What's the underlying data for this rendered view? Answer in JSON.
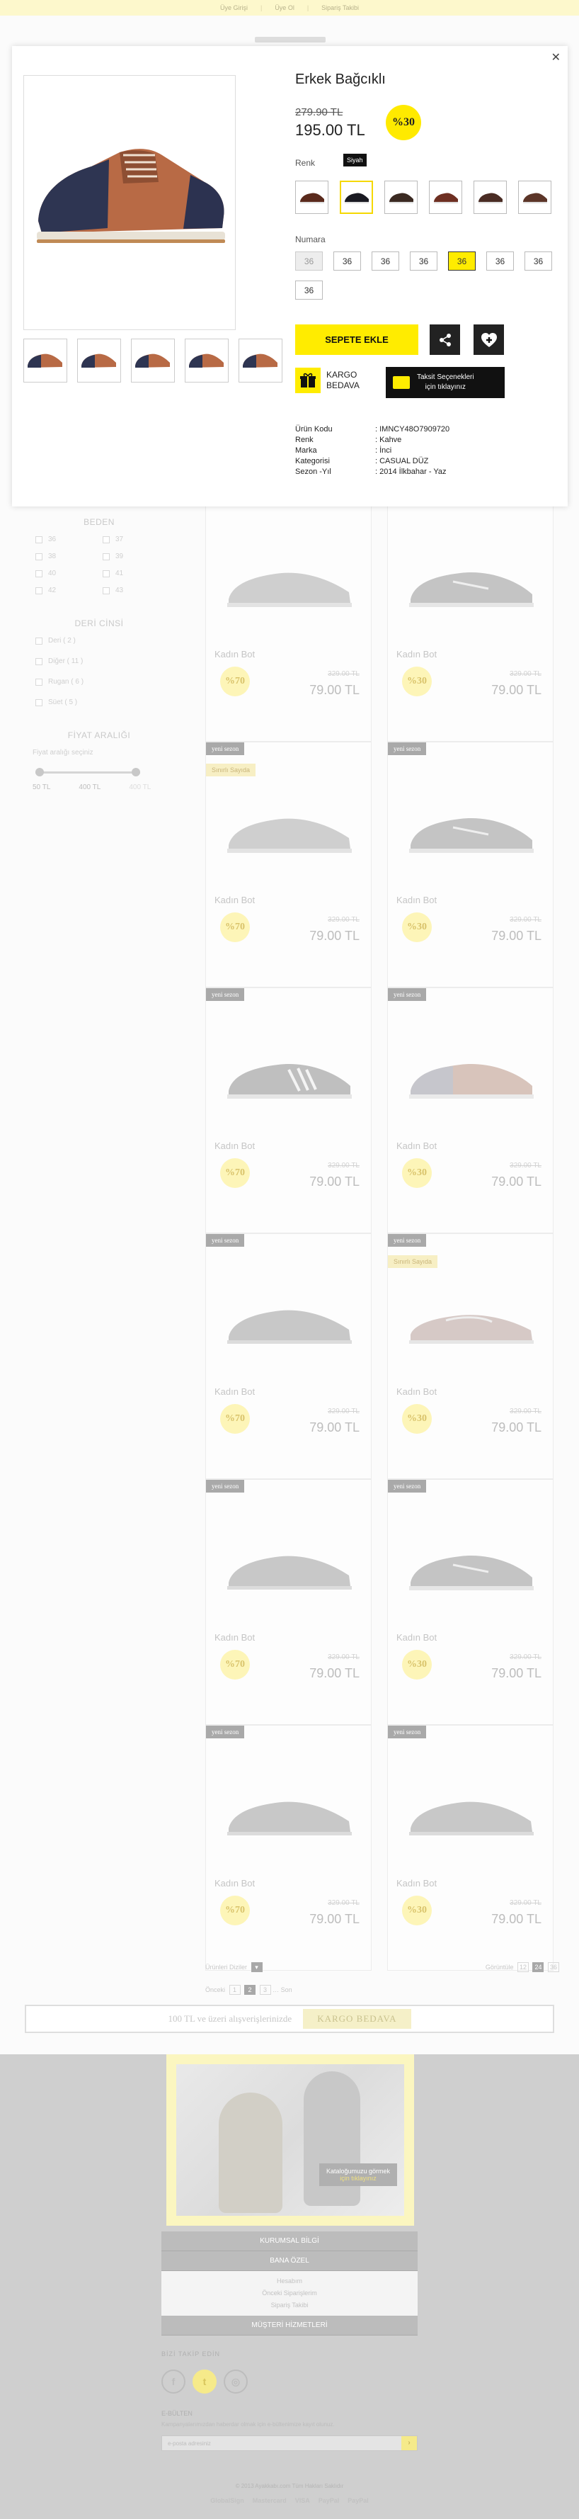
{
  "topbar": {
    "links": [
      "Üye Girişi",
      "Üye Ol",
      "Sipariş Takibi"
    ]
  },
  "sidebar": {
    "size_title": "BEDEN",
    "sizes": [
      "36",
      "37",
      "38",
      "39",
      "40",
      "41",
      "42",
      "43"
    ],
    "leather_title": "DERİ CİNSİ",
    "leathers": [
      "Deri ( 2 )",
      "Diğer ( 11 )",
      "Rugan ( 6 )",
      "Süet ( 5 )"
    ],
    "price_title": "FİYAT ARALIĞI",
    "price_placeholder": "Fiyat aralığı seçiniz",
    "price_min": "50 TL",
    "price_max": "400 TL",
    "price_extra": "400 TL"
  },
  "products": [
    {
      "badge": "",
      "ribbon": "",
      "name": "Kadın Bot",
      "discount": "%70",
      "old_price": "329.00 TL",
      "price": "79.00 TL",
      "shoe": "brogue"
    },
    {
      "badge": "",
      "ribbon": "",
      "name": "Kadın Bot",
      "discount": "%30",
      "old_price": "329.00 TL",
      "price": "79.00 TL",
      "shoe": "sport"
    },
    {
      "badge": "yeni sezon",
      "ribbon": "Sınırlı Sayıda",
      "name": "Kadın Bot",
      "discount": "%70",
      "old_price": "329.00 TL",
      "price": "79.00 TL",
      "shoe": "brogue"
    },
    {
      "badge": "yeni sezon",
      "ribbon": "",
      "name": "Kadın Bot",
      "discount": "%30",
      "old_price": "329.00 TL",
      "price": "79.00 TL",
      "shoe": "sport"
    },
    {
      "badge": "yeni sezon",
      "ribbon": "",
      "name": "Kadın Bot",
      "discount": "%70",
      "old_price": "329.00 TL",
      "price": "79.00 TL",
      "shoe": "sneaker"
    },
    {
      "badge": "yeni sezon",
      "ribbon": "",
      "name": "Kadın Bot",
      "discount": "%30",
      "old_price": "329.00 TL",
      "price": "79.00 TL",
      "shoe": "casual"
    },
    {
      "badge": "yeni sezon",
      "ribbon": "",
      "name": "Kadın Bot",
      "discount": "%70",
      "old_price": "329.00 TL",
      "price": "79.00 TL",
      "shoe": "oxford"
    },
    {
      "badge": "yeni sezon",
      "ribbon": "Sınırlı Sayıda",
      "name": "Kadın Bot",
      "discount": "%30",
      "old_price": "329.00 TL",
      "price": "79.00 TL",
      "shoe": "loafer"
    },
    {
      "badge": "yeni sezon",
      "ribbon": "",
      "name": "Kadın Bot",
      "discount": "%70",
      "old_price": "329.00 TL",
      "price": "79.00 TL",
      "shoe": "oxford"
    },
    {
      "badge": "yeni sezon",
      "ribbon": "",
      "name": "Kadın Bot",
      "discount": "%30",
      "old_price": "329.00 TL",
      "price": "79.00 TL",
      "shoe": "sport"
    },
    {
      "badge": "yeni sezon",
      "ribbon": "",
      "name": "Kadın Bot",
      "discount": "%70",
      "old_price": "329.00 TL",
      "price": "79.00 TL",
      "shoe": "oxford"
    },
    {
      "badge": "yeni sezon",
      "ribbon": "",
      "name": "Kadın Bot",
      "discount": "%30",
      "old_price": "329.00 TL",
      "price": "79.00 TL",
      "shoe": "oxford"
    }
  ],
  "pager": {
    "sort_label": "Ürünleri Diziler",
    "per_page_label": "Görüntüle",
    "per_page_options": [
      "12",
      "24",
      "36"
    ],
    "pages": [
      "1",
      "2",
      "3"
    ],
    "prev": "Önceki",
    "next": "Son"
  },
  "shipbar": {
    "text": "100 TL ve üzeri alışverişlerinizde",
    "badge": "KARGO BEDAVA"
  },
  "footer": {
    "promo_cta_line1": "Kataloğumuzu görmek",
    "promo_cta_line2": "için tıklayınız",
    "menu": [
      {
        "title": "KURUMSAL BİLGİ",
        "items": []
      },
      {
        "title": "BANA ÖZEL",
        "items": [
          "Hesabım",
          "Önceki Siparişlerim",
          "Sipariş Takibi"
        ]
      },
      {
        "title": "MÜŞTERİ HİZMETLERİ",
        "items": []
      }
    ],
    "social_title": "BİZİ TAKİP EDİN",
    "newsletter_title": "E-BÜLTEN",
    "newsletter_desc": "Kampanyalarımızdan haberdar olmak için e-bültenimize kayıt olunuz.",
    "newsletter_placeholder": "e-posta adresiniz",
    "copyright": "© 2013 Ayakkabı.com Tüm Hakları Saklıdır",
    "pay_logos": [
      "GlobalSign",
      "Mastercard",
      "VISA",
      "PayPal",
      "PayPal"
    ]
  },
  "modal": {
    "title": "Erkek Bağcıklı",
    "old_price": "279.90 TL",
    "price": "195.00 TL",
    "discount": "%30",
    "color_label": "Renk",
    "color_tooltip": "Siyah",
    "number_label": "Numara",
    "sizes": [
      {
        "v": "36",
        "state": "dis"
      },
      {
        "v": "36",
        "state": ""
      },
      {
        "v": "36",
        "state": ""
      },
      {
        "v": "36",
        "state": ""
      },
      {
        "v": "36",
        "state": "sel"
      },
      {
        "v": "36",
        "state": ""
      },
      {
        "v": "36",
        "state": ""
      },
      {
        "v": "36",
        "state": ""
      }
    ],
    "add_to_cart": "SEPETE EKLE",
    "free_ship_line1": "KARGO",
    "free_ship_line2": "BEDAVA",
    "installment_line1": "Taksit Seçenekleri",
    "installment_line2": "için tıklayınız",
    "specs": [
      {
        "k": "Ürün Kodu",
        "v": ": IMNCY48O7909720"
      },
      {
        "k": "Renk",
        "v": ": Kahve"
      },
      {
        "k": "Marka",
        "v": ": İnci"
      },
      {
        "k": "Kategorisi",
        "v": ": CASUAL DÜZ"
      },
      {
        "k": "Sezon -Yıl",
        "v": ": 2014 İlkbahar - Yaz"
      }
    ],
    "colors": {
      "accent": "#ffec00",
      "dark": "#111111"
    }
  }
}
